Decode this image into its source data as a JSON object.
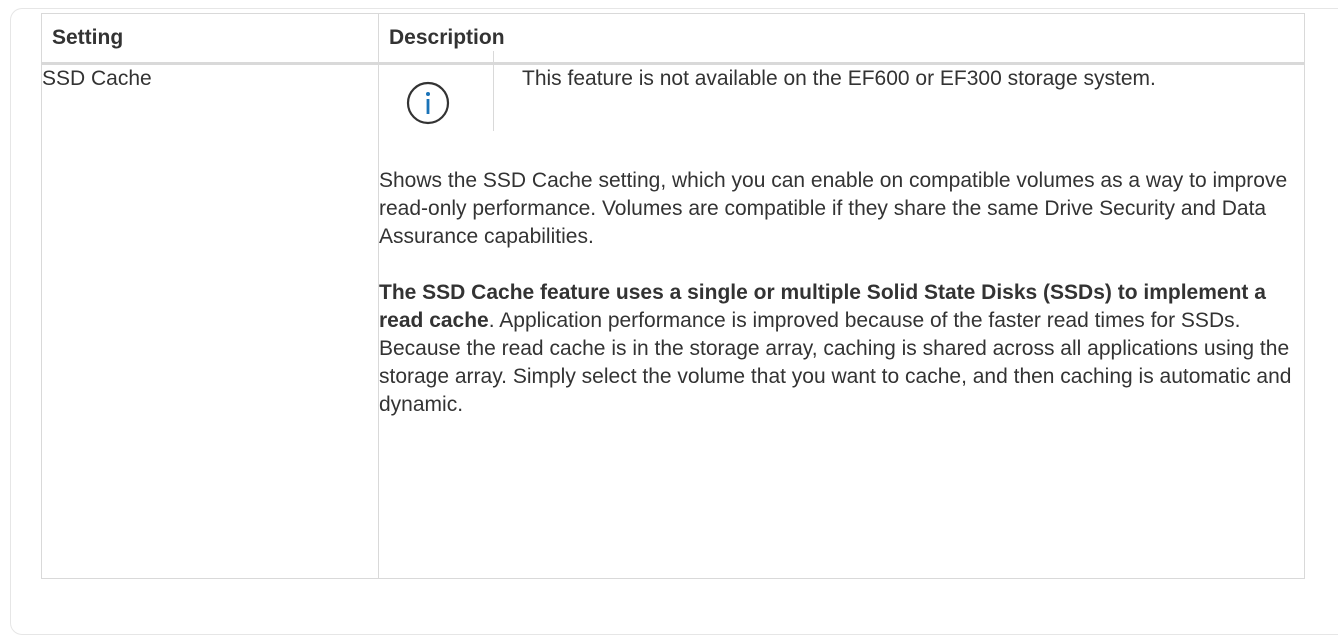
{
  "table": {
    "headers": {
      "setting": "Setting",
      "description": "Description"
    },
    "rows": [
      {
        "setting": "SSD Cache",
        "note": {
          "icon": "info-circle-icon",
          "icon_color": "#1a73b8",
          "text": "This feature is not available on the EF600 or EF300 storage system."
        },
        "paragraph1": "Shows the SSD Cache setting, which you can enable on compatible volumes as a way to improve read-only performance. Volumes are compatible if they share the same Drive Security and Data Assurance capabilities.",
        "paragraph2_bold": "The SSD Cache feature uses a single or multiple Solid State Disks (SSDs) to implement a read cache",
        "paragraph2_rest": ". Application performance is improved because of the faster read times for SSDs. Because the read cache is in the storage array, caching is shared across all applications using the storage array. Simply select the volume that you want to cache, and then caching is automatic and dynamic."
      }
    ]
  }
}
